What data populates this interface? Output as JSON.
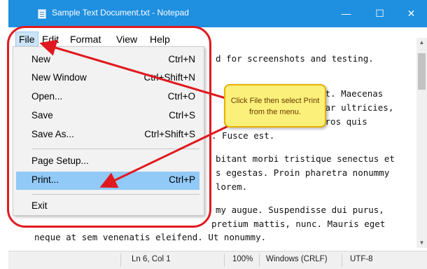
{
  "window": {
    "title": "Sample Text Document.txt - Notepad",
    "minimize": "—",
    "maximize": "☐",
    "close": "✕"
  },
  "menubar": {
    "items": [
      "File",
      "Edit",
      "Format",
      "View",
      "Help"
    ]
  },
  "file_menu": {
    "items": [
      {
        "label": "New",
        "shortcut": "Ctrl+N"
      },
      {
        "label": "New Window",
        "shortcut": "Ctrl+Shift+N"
      },
      {
        "label": "Open...",
        "shortcut": "Ctrl+O"
      },
      {
        "label": "Save",
        "shortcut": "Ctrl+S"
      },
      {
        "label": "Save As...",
        "shortcut": "Ctrl+Shift+S"
      },
      {
        "label": "Page Setup...",
        "shortcut": ""
      },
      {
        "label": "Print...",
        "shortcut": "Ctrl+P"
      },
      {
        "label": "Exit",
        "shortcut": ""
      }
    ],
    "highlighted": "Print..."
  },
  "editor": {
    "lines": [
      "d for screenshots and testing.",
      "it. Maecenas",
      "nar ultricies,",
      "eros quis",
      ". Fusce est.",
      "bitant morbi tristique senectus et",
      "s egestas. Proin pharetra nonummy",
      "lorem.",
      "my augue. Suspendisse dui purus,",
      "pretium mattis, nunc. Mauris eget",
      "neque at sem venenatis eleifend. Ut nonummy."
    ]
  },
  "status": {
    "position": "Ln 6, Col 1",
    "zoom": "100%",
    "line_endings": "Windows (CRLF)",
    "encoding": "UTF-8"
  },
  "annotation": {
    "callout_text": "Click File then select Print from the menu.",
    "ring_color": "#e0191f",
    "callout_color": "#fbf07a"
  },
  "colors": {
    "titlebar": "#1f8fe0",
    "highlight": "#91c9f7"
  }
}
